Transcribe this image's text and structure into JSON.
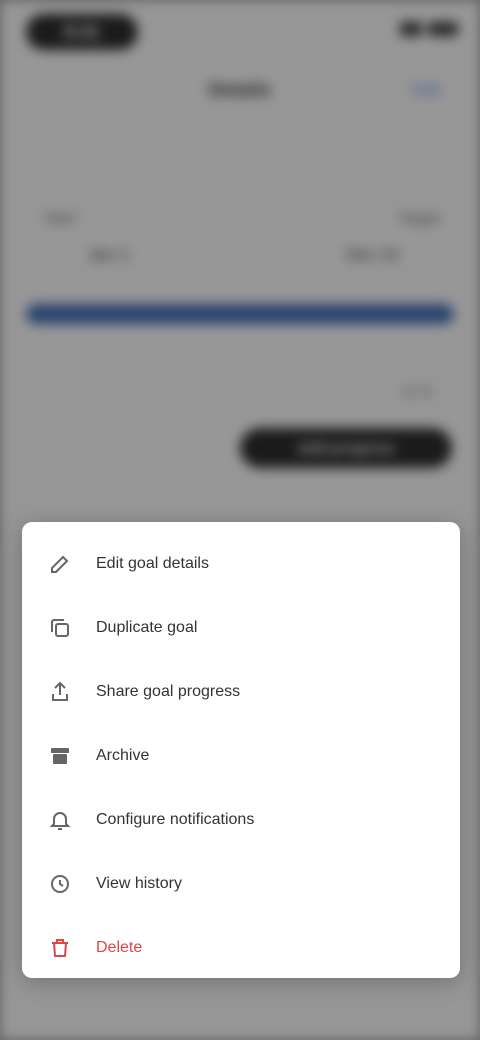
{
  "status_bar": {
    "time": "9:41"
  },
  "nav": {
    "title": "Details",
    "action": "Edit"
  },
  "summary": {
    "left_label": "Start",
    "left_value": "Jan 1",
    "right_label": "Target",
    "right_value": "Dec 31"
  },
  "progress": {
    "fraction": 1.0,
    "color": "#2d5aa8"
  },
  "readout": "0 / 0",
  "primary_button": "Add progress",
  "menu": {
    "items": [
      {
        "icon": "pencil-icon",
        "label": "Edit goal details"
      },
      {
        "icon": "copy-icon",
        "label": "Duplicate goal"
      },
      {
        "icon": "share-icon",
        "label": "Share goal progress"
      },
      {
        "icon": "archive-icon",
        "label": "Archive"
      },
      {
        "icon": "bell-icon",
        "label": "Configure notifications"
      },
      {
        "icon": "history-icon",
        "label": "View history"
      },
      {
        "icon": "trash-icon",
        "label": "Delete",
        "danger": true
      }
    ]
  }
}
